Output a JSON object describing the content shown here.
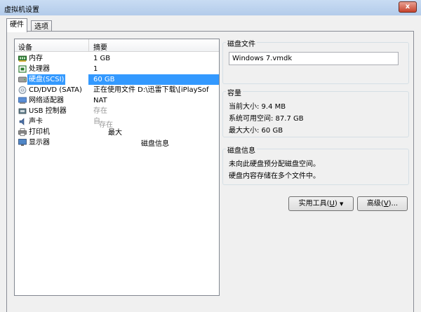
{
  "window": {
    "title": "虚拟机设置",
    "close_glyph": "x"
  },
  "tabs": [
    {
      "label": "硬件"
    },
    {
      "label": "选项"
    }
  ],
  "devices": {
    "col_device": "设备",
    "col_summary": "摘要",
    "items": [
      {
        "name": "内存",
        "summary": "1 GB",
        "icon": "memory-icon"
      },
      {
        "name": "处理器",
        "summary": "1",
        "icon": "processor-icon"
      },
      {
        "name": "硬盘(SCSI)",
        "summary": "60 GB",
        "icon": "hard-disk-icon"
      },
      {
        "name": "CD/DVD (SATA)",
        "summary": "正在使用文件 D:\\迅雷下载\\[iPlaySof",
        "icon": "cd-dvd-icon"
      },
      {
        "name": "网络适配器",
        "summary": "NAT",
        "icon": "network-adapter-icon"
      },
      {
        "name": "USB 控制器",
        "summary": "存在",
        "icon": "usb-controller-icon"
      },
      {
        "name": "声卡",
        "summary": "自",
        "icon": "sound-card-icon"
      },
      {
        "name": "打印机",
        "summary": "",
        "icon": "printer-icon"
      },
      {
        "name": "显示器",
        "summary": "",
        "icon": "monitor-icon"
      }
    ],
    "ghost_texts": {
      "a": "存在",
      "b": "最大",
      "c": "磁盘信息"
    },
    "selected_index": 2
  },
  "disk_file": {
    "label": "磁盘文件",
    "value": "Windows 7.vmdk"
  },
  "capacity": {
    "label": "容量",
    "current": "当前大小: 9.4 MB",
    "free": "系统可用空间: 87.7 GB",
    "max": "最大大小: 60 GB"
  },
  "disk_info": {
    "label": "磁盘信息",
    "line1": "未向此硬盘预分配磁盘空间。",
    "line2": "硬盘内容存储在多个文件中。"
  },
  "buttons": {
    "utilities_pre": "实用工具(",
    "utilities_key": "U",
    "utilities_post": ")",
    "utilities_arrow": "▼",
    "advanced_pre": "高级(",
    "advanced_key": "V",
    "advanced_post": ")..."
  },
  "colors": {
    "selection": "#3399ff",
    "title_bar": "#c9dcf3"
  }
}
